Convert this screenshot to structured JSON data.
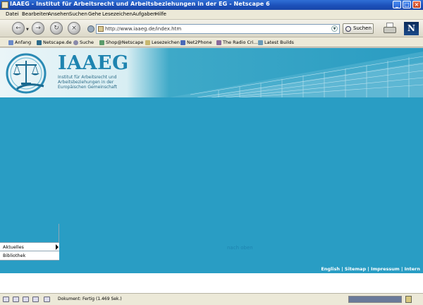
{
  "window": {
    "title": "IAAEG - Institut für Arbeitsrecht und Arbeitsbeziehungen in der EG - Netscape 6",
    "min_label": "_",
    "max_label": "□",
    "close_label": "×"
  },
  "menu": [
    "Datei",
    "Bearbeiten",
    "Ansehen",
    "Suchen",
    "Gehe",
    "Lesezeichen",
    "Aufgaben",
    "Hilfe"
  ],
  "nav": {
    "back_icon": "←",
    "forward_icon": "→",
    "reload_icon": "↻",
    "stop_icon": "×",
    "url": "http://www.iaaeg.de/index.htm",
    "search_label": "Suchen"
  },
  "personal_toolbar": [
    "Anfang",
    "Netscape.de",
    "Suche",
    "Shop@Netscape",
    "Lesezeichen",
    "Net2Phone",
    "The Radio Cri...",
    "Latest Builds"
  ],
  "page": {
    "brand": "IAAEG",
    "tagline": "Institut für Arbeitsrecht und Arbeitsbeziehungen in der Europäischen Gemeinschaft",
    "footer_links": [
      "English",
      "Sitemap",
      "Impressum",
      "Intern"
    ],
    "sidebar": [
      "Aktuelles",
      "Bibliothek"
    ],
    "back_to_top": "nach oben"
  },
  "status": {
    "text": "Dokument: Fertig (1.469 Sek.)",
    "progress": 1.0
  },
  "colors": {
    "banner": "#299dc4",
    "brand": "#1e84b0",
    "titlebar": "#2f6fd6"
  }
}
